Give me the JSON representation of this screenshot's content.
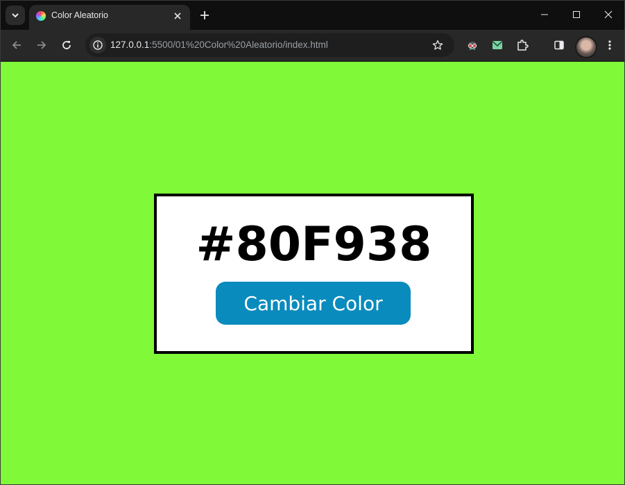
{
  "browser": {
    "tab": {
      "title": "Color Aleatorio"
    },
    "address_bar": {
      "host": "127.0.0.1",
      "path": ":5500/01%20Color%20Aleatorio/index.html"
    }
  },
  "page": {
    "background_color": "#80F938",
    "hex_label": "#80F938",
    "button_label": "Cambiar Color",
    "button_color": "#0A8BBD"
  },
  "icons": {
    "tab_search": "chevron-down-icon",
    "new_tab": "plus-icon",
    "minimize": "minimize-icon",
    "maximize": "maximize-icon",
    "close": "close-icon",
    "back": "back-arrow-icon",
    "forward": "forward-arrow-icon",
    "reload": "reload-icon",
    "site_info": "info-icon",
    "bookmark": "star-icon",
    "extensions": [
      "spy-extension-icon",
      "mail-extension-icon",
      "puzzle-icon"
    ],
    "side_panel": "side-panel-icon",
    "menu": "kebab-menu-icon"
  }
}
